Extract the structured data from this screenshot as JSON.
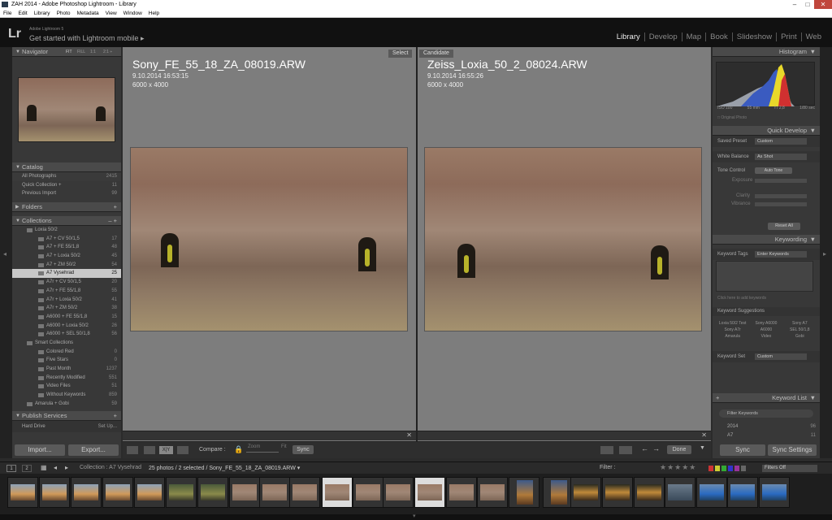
{
  "window": {
    "title": "ZAH 2014 - Adobe Photoshop Lightroom - Library"
  },
  "menu": [
    "File",
    "Edit",
    "Library",
    "Photo",
    "Metadata",
    "View",
    "Window",
    "Help"
  ],
  "identity": {
    "logo": "Lr",
    "version": "Adobe Lightroom 5",
    "mobile": "Get started with Lightroom mobile ▸"
  },
  "modules": [
    "Library",
    "Develop",
    "Map",
    "Book",
    "Slideshow",
    "Print",
    "Web"
  ],
  "navigator": {
    "title": "Navigator",
    "zoom": [
      "FIT",
      "FILL",
      "1:1",
      "2:1 ÷"
    ]
  },
  "catalog": {
    "title": "Catalog",
    "items": [
      {
        "label": "All Photographs",
        "count": "2415"
      },
      {
        "label": "Quick Collection +",
        "count": "11"
      },
      {
        "label": "Previous Import",
        "count": "99"
      }
    ]
  },
  "folders": {
    "title": "Folders"
  },
  "collections": {
    "title": "Collections",
    "items": [
      {
        "label": "Loxia 50/2",
        "count": ""
      },
      {
        "label": "A7 + CV 50/1,5",
        "count": "17"
      },
      {
        "label": "A7 + FE 55/1,8",
        "count": "48"
      },
      {
        "label": "A7 + Loxia 50/2",
        "count": "45"
      },
      {
        "label": "A7 + ZM 50/2",
        "count": "54"
      },
      {
        "label": "A7 Vysehrad",
        "count": "25"
      },
      {
        "label": "A7r + CV 50/1,5",
        "count": "20"
      },
      {
        "label": "A7r + FE 55/1,8",
        "count": "55"
      },
      {
        "label": "A7r + Loxia 50/2",
        "count": "41"
      },
      {
        "label": "A7r + ZM 50/2",
        "count": "38"
      },
      {
        "label": "A6000 + FE 55/1,8",
        "count": "15"
      },
      {
        "label": "A6000 + Loxia 50/2",
        "count": "26"
      },
      {
        "label": "A6000 + SEL 50/1,8",
        "count": "56"
      },
      {
        "label": "Smart Collections",
        "count": ""
      },
      {
        "label": "Colored Red",
        "count": "0"
      },
      {
        "label": "Five Stars",
        "count": "0"
      },
      {
        "label": "Past Month",
        "count": "1237"
      },
      {
        "label": "Recently Modified",
        "count": "551"
      },
      {
        "label": "Video Files",
        "count": "51"
      },
      {
        "label": "Without Keywords",
        "count": "859"
      },
      {
        "label": "Amarula + Gobi",
        "count": "59"
      }
    ]
  },
  "publish": {
    "title": "Publish Services",
    "hard_drive": "Hard Drive",
    "setup": "Set Up..."
  },
  "left_buttons": {
    "import": "Import...",
    "export": "Export..."
  },
  "select": {
    "tag": "Select",
    "file": "Sony_FE_55_18_ZA_08019.ARW",
    "date": "9.10.2014 16:53:15",
    "dims": "6000 x 4000"
  },
  "candidate": {
    "tag": "Candidate",
    "file": "Zeiss_Loxia_50_2_08024.ARW",
    "date": "9.10.2014 16:55:26",
    "dims": "6000 x 4000"
  },
  "toolbar": {
    "compare": "Compare :",
    "zoom": "Zoom",
    "fit": "Fit",
    "sync": "Sync",
    "done": "Done",
    "xy": "X|Y"
  },
  "histogram": {
    "title": "Histogram",
    "iso": "ISO 100",
    "focal": "55 mm",
    "aperture": "f / 2,8",
    "shutter": "1/80 sec",
    "original": "Original Photo"
  },
  "quick_develop": {
    "title": "Quick Develop",
    "saved_preset_label": "Saved Preset",
    "saved_preset": "Custom",
    "white_balance_label": "White Balance",
    "white_balance": "As Shot",
    "tone_control_label": "Tone Control",
    "auto_tone": "Auto Tone",
    "exposure": "Exposure",
    "clarity": "Clarity",
    "vibrance": "Vibrance",
    "reset": "Reset All"
  },
  "keywording": {
    "title": "Keywording",
    "tags_label": "Keyword Tags",
    "tags_mode": "Enter Keywords",
    "placeholder": "Click here to add keywords",
    "suggestions_title": "Keyword Suggestions",
    "suggestions": [
      "Loxia 50/2 Test",
      "Sony A6000",
      "Sony A7",
      "Sony A7r",
      "A6000",
      "SEL 50/1,8",
      "Amarula",
      "Video",
      "Gobi"
    ],
    "set_label": "Keyword Set",
    "set_value": "Custom"
  },
  "keyword_list": {
    "title": "Keyword List",
    "filter": "Filter Keywords",
    "items": [
      {
        "label": "2014",
        "count": "96"
      },
      {
        "label": "A7",
        "count": "11"
      }
    ]
  },
  "sync": {
    "sync": "Sync",
    "sync_settings": "Sync Settings"
  },
  "filmbar": {
    "pages": [
      "1",
      "2"
    ],
    "path_prefix": "Collection : A7 Vysehrad",
    "summary": "25 photos / 2 selected / Sony_FE_55_18_ZA_08019.ARW ▾",
    "filter_label": "Filter :",
    "filter_value": "Filters Off"
  },
  "colors": {
    "accent": "#e0e0e0",
    "panel": "#383838",
    "center": "#7d7d7d"
  }
}
